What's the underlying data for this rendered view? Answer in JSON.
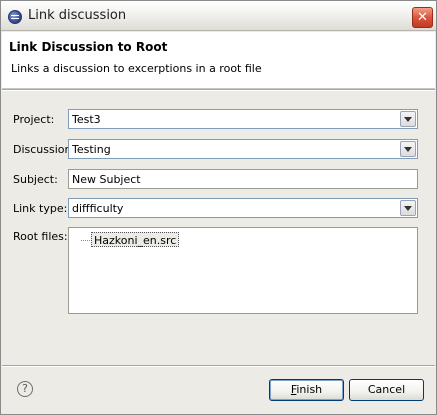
{
  "window": {
    "title": "Link discussion",
    "close_glyph": "✕"
  },
  "header": {
    "title": "Link Discussion to Root",
    "description": "Links a discussion to excerptions in a root file"
  },
  "form": {
    "project": {
      "label": "Project:",
      "value": "Test3"
    },
    "discussion": {
      "label": "Discussion",
      "value": "Testing"
    },
    "subject": {
      "label": "Subject:",
      "value": "New Subject"
    },
    "link_type": {
      "label": "Link type:",
      "value": "diffficulty"
    },
    "root_files": {
      "label": "Root files:",
      "items": [
        "Hazkoni_en.src"
      ]
    }
  },
  "footer": {
    "help_glyph": "?",
    "finish_mnemonic": "F",
    "finish_rest": "inish",
    "cancel_label": "Cancel"
  },
  "icons": {
    "app": "eclipse-icon",
    "close": "close-icon",
    "help": "help-icon",
    "dropdown": "chevron-down-icon"
  },
  "colors": {
    "dialog_bg": "#ecebe6",
    "field_border": "#7f9db9",
    "button_border": "#003c74",
    "close_button": "#d9553b"
  }
}
